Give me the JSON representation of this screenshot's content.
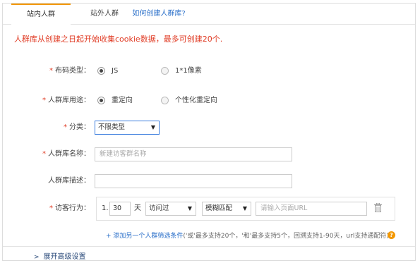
{
  "tabs": {
    "inside": "站内人群",
    "outside": "站外人群",
    "help": "如何创建人群库?"
  },
  "notice": "人群库从创建之日起开始收集cookie数据，最多可创建20个.",
  "form": {
    "code_type": {
      "required_mark": "*",
      "label": "布码类型：",
      "options": [
        "JS",
        "1*1像素"
      ],
      "selected": "JS"
    },
    "usage": {
      "required_mark": "*",
      "label": "人群库用途：",
      "options": [
        "重定向",
        "个性化重定向"
      ],
      "selected": "重定向"
    },
    "category": {
      "required_mark": "*",
      "label": "分类：",
      "value": "不限类型"
    },
    "name": {
      "required_mark": "*",
      "label": "人群库名称：",
      "placeholder": "新建访客群名称"
    },
    "description": {
      "label": "人群库描述：",
      "value": ""
    },
    "visitor": {
      "required_mark": "*",
      "label": "访客行为：",
      "index": "1.",
      "days": "30",
      "days_unit": "天",
      "action": "访问过",
      "match": "模糊匹配",
      "url_placeholder": "请输入页面URL"
    }
  },
  "add_rule": {
    "link": "+ 添加另一个人群筛选条件",
    "hint": "('或'最多支持20个，'和'最多支持5个，回溯支持1-90天，url支持通配符)",
    "help_icon": "?"
  },
  "advanced": {
    "label": "展开高级设置",
    "icon": "chevron-right-icon"
  },
  "colors": {
    "accent": "#f39800",
    "link": "#2a6fc9",
    "required": "#e03b24"
  }
}
